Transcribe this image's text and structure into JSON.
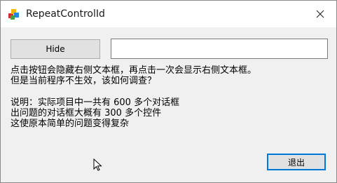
{
  "window": {
    "title": "RepeatControlId",
    "app_icon": "colored-blocks-icon",
    "close_icon": "close-icon"
  },
  "form": {
    "hide_button_label": "Hide",
    "textbox_value": "",
    "description_lines": [
      "点击按钮会隐藏右侧文本框，再点击一次会显示右侧文本框。",
      "但是当前程序不生效，该如何调查？"
    ],
    "note_lines": [
      "说明：实际项目中一共有 600 多个对话框",
      "出问题的对话框大概有 300 多个控件",
      "这使原本简单的问题变得复杂"
    ],
    "exit_button_label": "退出"
  },
  "colors": {
    "accent": "#0078d7",
    "button_face": "#e1e1e1",
    "dialog_bg": "#f0f0f0"
  }
}
